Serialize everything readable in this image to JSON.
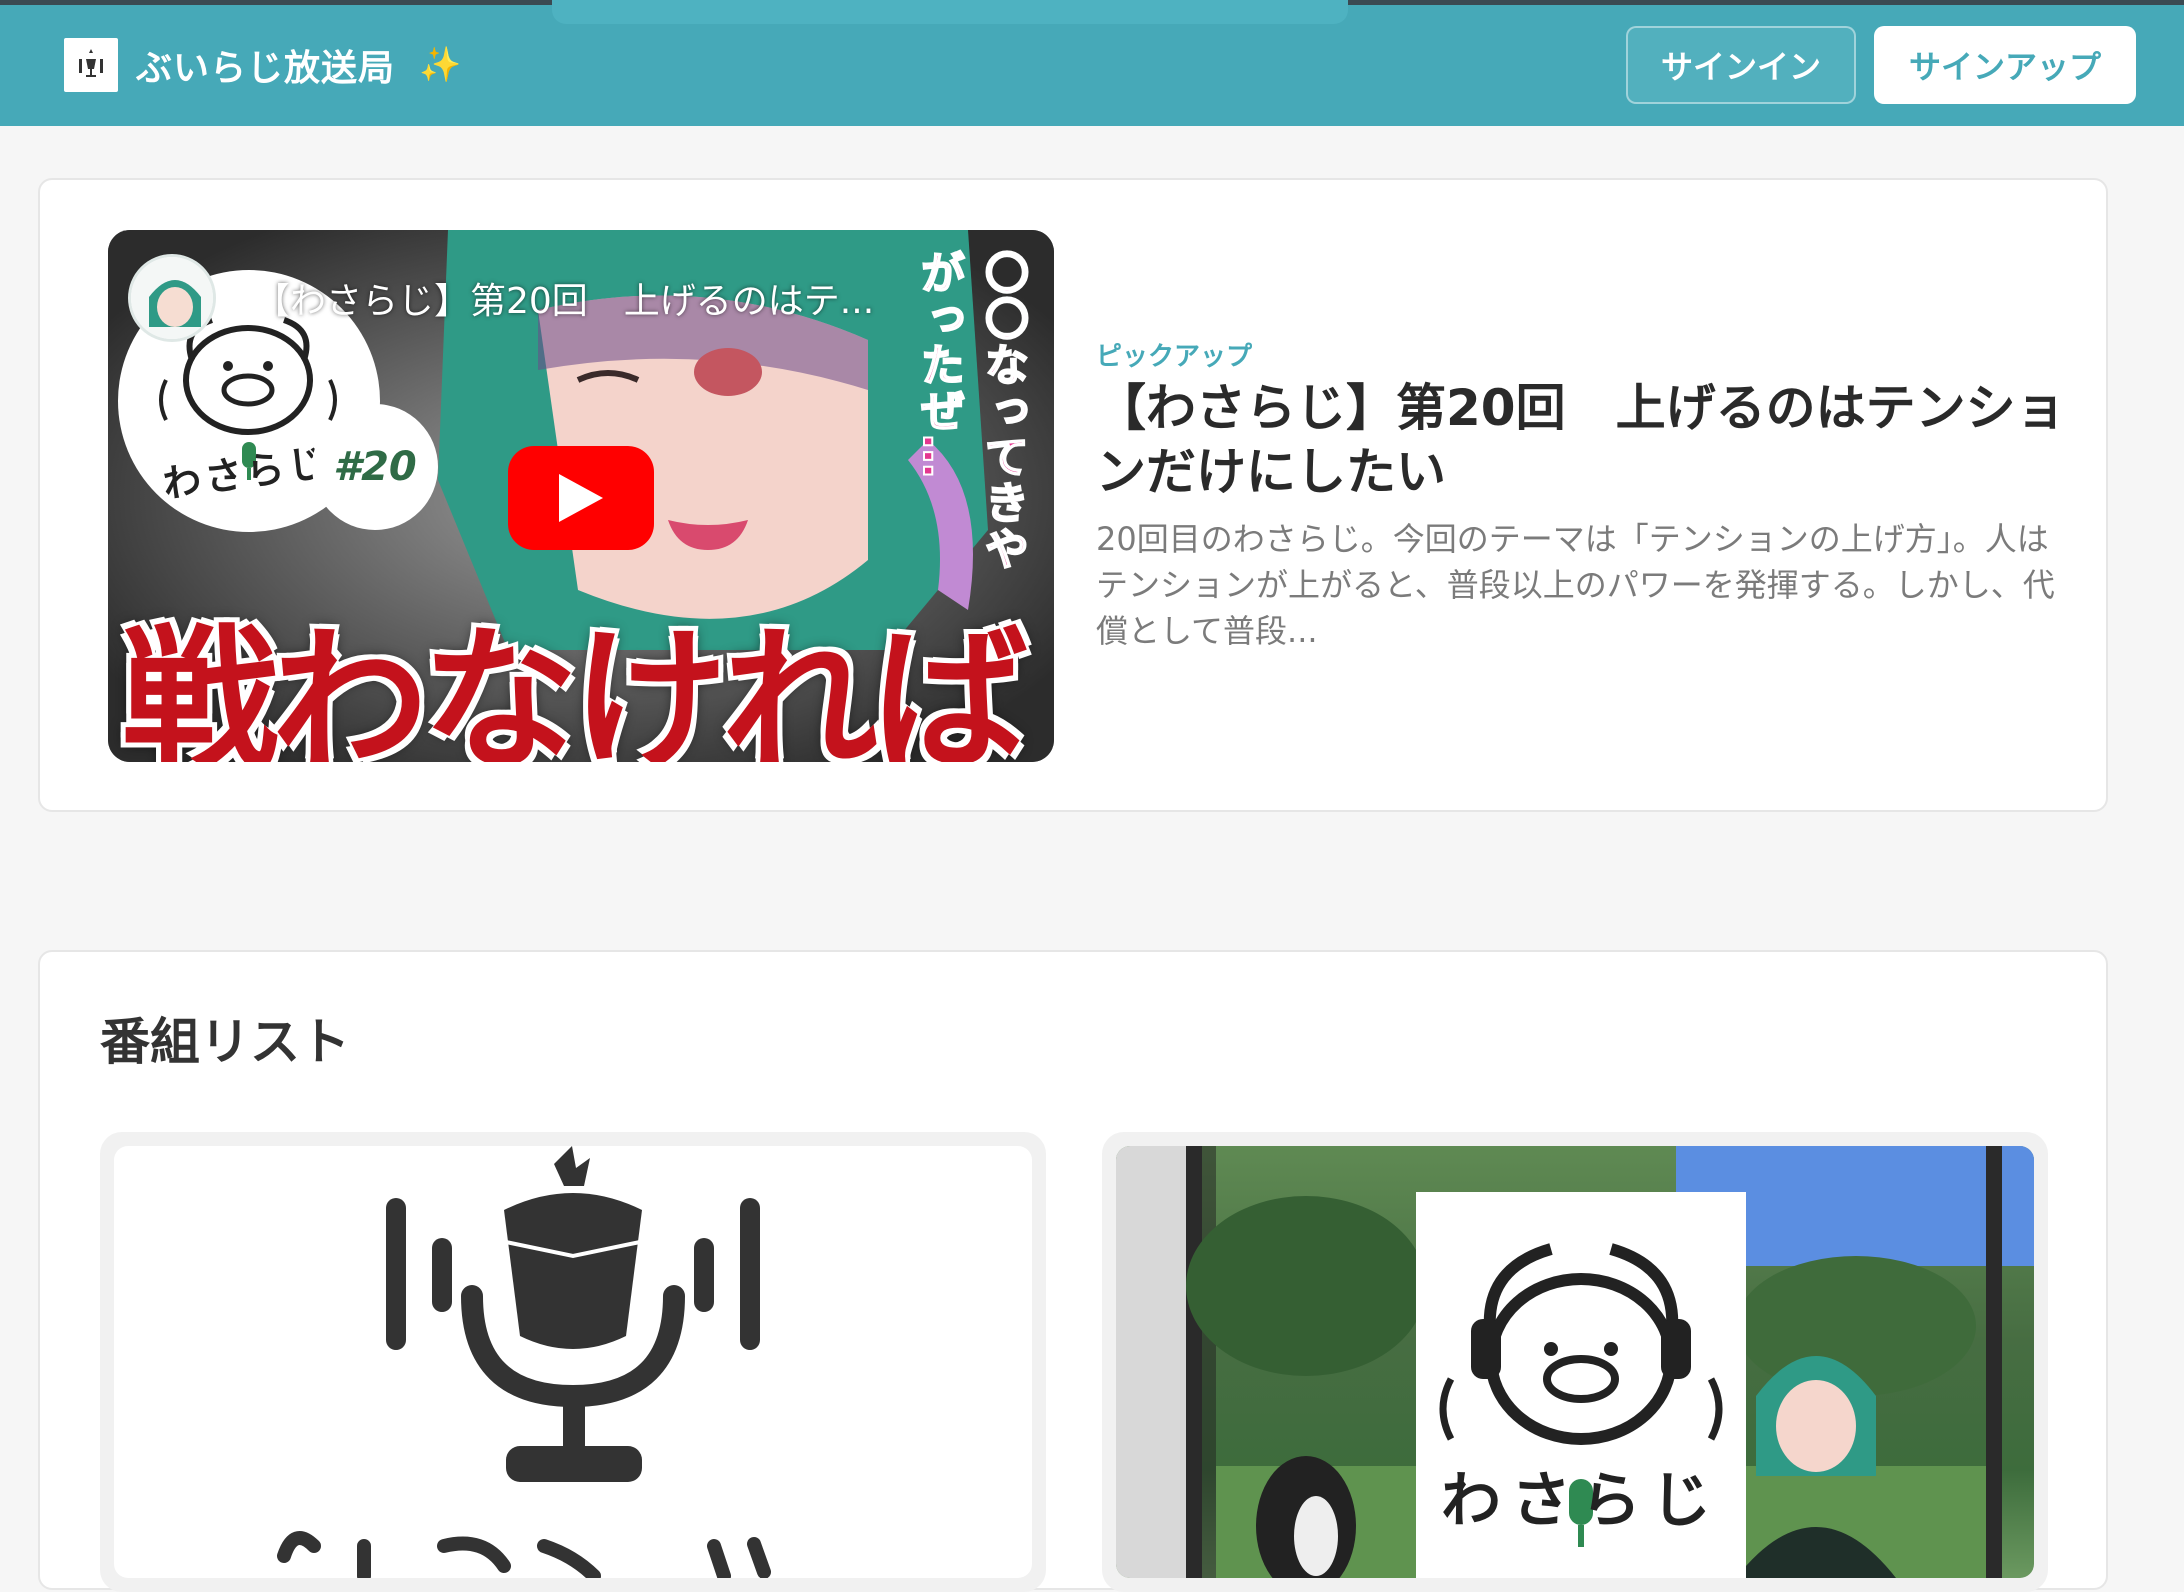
{
  "header": {
    "site_title": "ぶいらじ放送局",
    "sparkle_icon": "sparkles-icon",
    "signin_label": "サインイン",
    "signup_label": "サインアップ",
    "brand_color": "#46a9b8"
  },
  "pickup": {
    "label": "ピックアップ",
    "title": "【わさらじ】第20回　上げるのはテンションだけにしたい",
    "description": "20回目のわさらじ。今回のテーマは「テンションの上げ方」。人はテンションが上がると、普段以上のパワーを発揮する。しかし、代償として普段...",
    "video": {
      "overlay_title": "【わさらじ】第20回　上げるのはテ...",
      "episode_badge": "#20",
      "show_logo_text": "わさらじ",
      "vertical_caption": "〇〇なってきやがったぜ…",
      "big_caption": "戦わなければ",
      "play_icon": "youtube-play-icon"
    }
  },
  "programs": {
    "heading": "番組リスト",
    "items": [
      {
        "logo_text": "いちらじ",
        "icon": "microphone-logo-icon"
      },
      {
        "logo_text": "わさらじ",
        "icon": "pig-headphones-logo-icon"
      }
    ]
  }
}
